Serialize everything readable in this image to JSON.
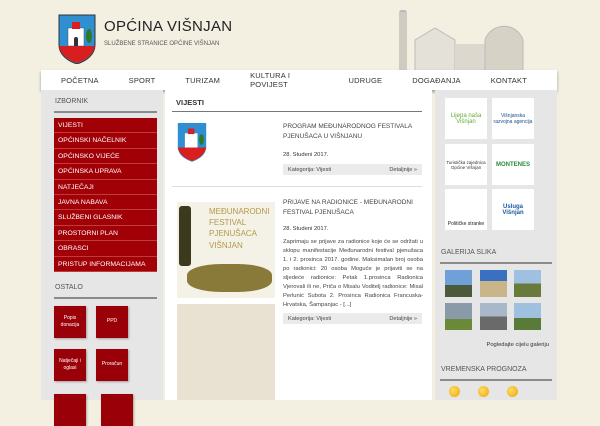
{
  "header": {
    "title": "OPĆINA VIŠNJAN",
    "subtitle": "SLUŽBENE STRANICE OPĆINE VIŠNJAN"
  },
  "nav": [
    "POČETNA",
    "SPORT",
    "TURIZAM",
    "KULTURA I POVIJEST",
    "UDRUGE",
    "DOGAĐANJA",
    "KONTAKT"
  ],
  "left": {
    "menu_title": "IZBORNIK",
    "menu": [
      "VIJESTI",
      "OPĆINSKI NAČELNIK",
      "OPĆINSKO VIJEĆE",
      "OPĆINSKA UPRAVA",
      "NATJEČAJI",
      "JAVNA NABAVA",
      "SLUŽBENI GLASNIK",
      "PROSTORNI PLAN",
      "OBRASCI",
      "PRISTUP INFORMACIJAMA"
    ],
    "other_title": "OSTALO",
    "tiles": [
      "Popis donacija",
      "PPD",
      "Natječaji i oglasi",
      "Proračun"
    ]
  },
  "center": {
    "title": "VIJESTI",
    "news": [
      {
        "title": "PROGRAM MEĐUNARODNOG FESTIVALA PJENUŠACA U VIŠNJANU",
        "date": "28. Studeni 2017.",
        "category": "Kategorija: Vijesti",
        "more": "Detaljnije »"
      },
      {
        "title": "PRIJAVE NA RADIONICE - MEĐUNARODNI FESTIVAL PJENUŠACA",
        "date": "28. Studeni 2017.",
        "text": "Zaprimaju se prijave za radionice koje će se održati u sklopu manifestacije Međunarodni festival pjenušaca 1. i 2. prosinca 2017. godine. Maksimalan broj osoba po radionici: 20 osoba Moguće je prijaviti se na sljedeće radionice: Petak 1.prosinca Radionica Vjerovali ili ne, Priča o Misalu Voditelj radionice: Misal Perlunić Subota 2. Prosinca Radionica Francuska-Hrvatska, Šampanjac - [...]",
        "category": "Kategorija: Vijesti",
        "more": "Detaljnije »",
        "poster_text": "MEĐUNARODNI FESTIVAL PJENUŠACA VIŠNJAN"
      }
    ]
  },
  "right": {
    "logos": [
      "Lijepa naša Višnjan",
      "Višnjanska razvojna agencija",
      "Turistička zajednica Općine Višnjan",
      "MONTENES",
      "Političke stranke",
      "Usluga Višnjan"
    ],
    "gallery_title": "GALERIJA SLIKA",
    "gallery_link": "Pogledajte cijelu galeriju",
    "weather_title": "VREMENSKA PROGNOZA"
  },
  "colors": {
    "menu_red": "#a00006",
    "background": "#f3f0e2"
  }
}
